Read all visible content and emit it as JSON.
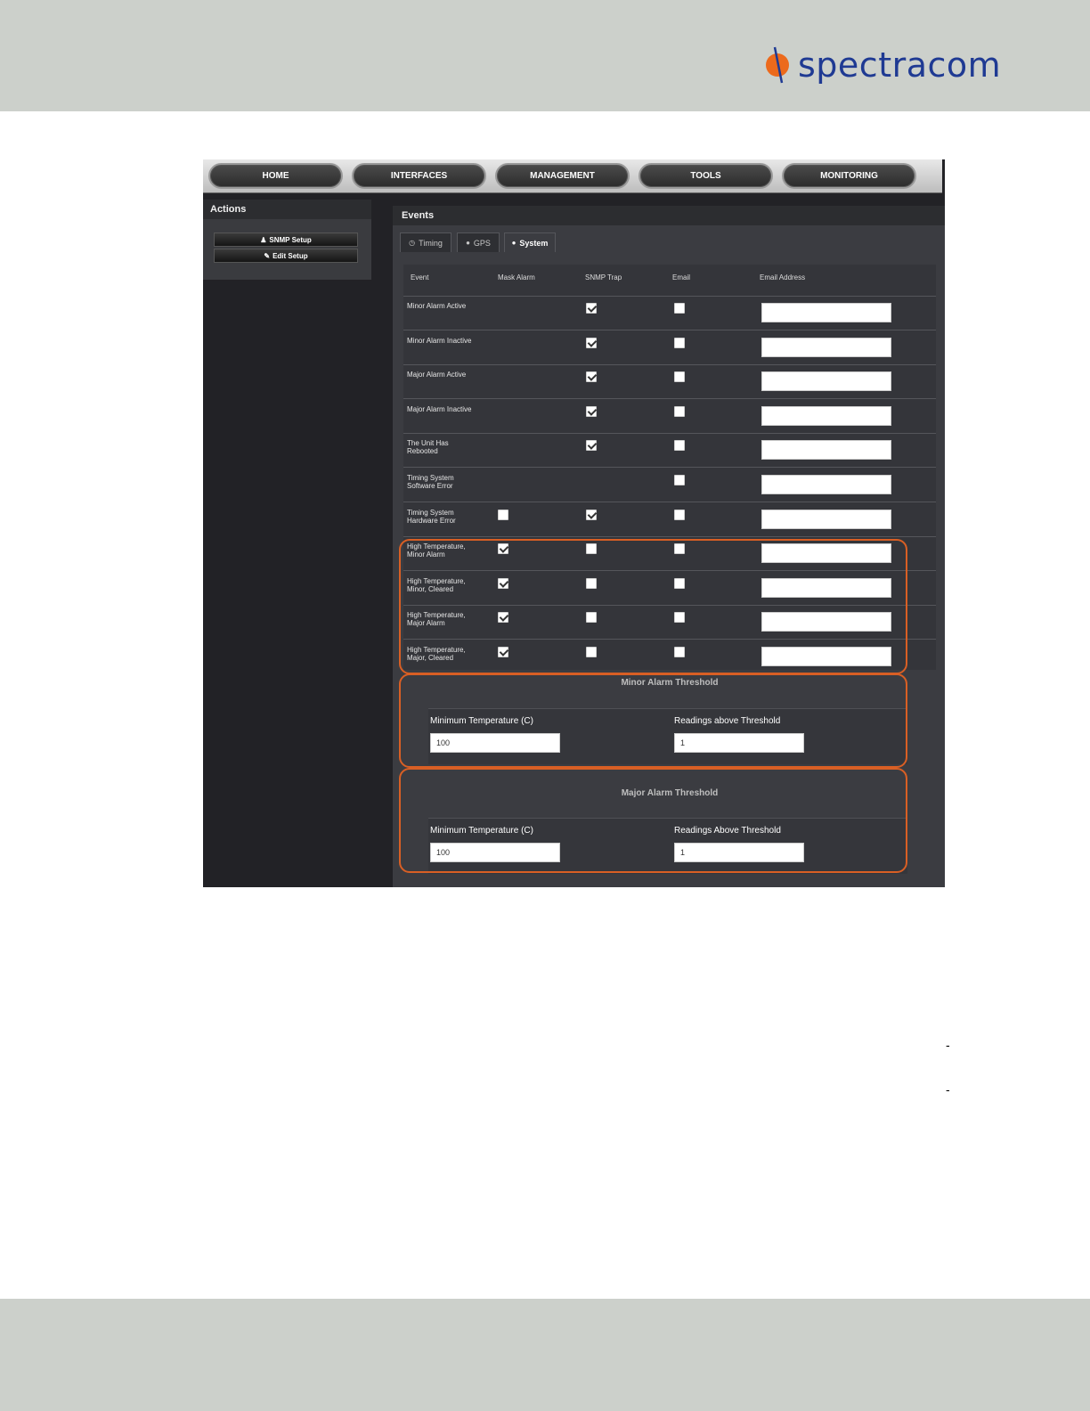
{
  "brand": {
    "logo_text": "spectracom",
    "colors": {
      "band": "#ccd0cb",
      "logo_blue": "#1f3a93",
      "logo_orange": "#ec6a1c",
      "highlight": "#d95f24"
    }
  },
  "nav": {
    "items": [
      "HOME",
      "INTERFACES",
      "MANAGEMENT",
      "TOOLS",
      "MONITORING"
    ]
  },
  "actions": {
    "title": "Actions",
    "buttons": [
      {
        "icon": "user-icon",
        "label": "SNMP Setup"
      },
      {
        "icon": "edit-icon",
        "label": "Edit Setup"
      }
    ]
  },
  "events": {
    "title": "Events",
    "tabs": [
      {
        "label": "Timing",
        "icon": "clock-icon",
        "active": false
      },
      {
        "label": "GPS",
        "icon": "globe-icon",
        "active": false
      },
      {
        "label": "System",
        "icon": "globe-icon",
        "active": true
      }
    ],
    "columns": [
      "Event",
      "Mask Alarm",
      "SNMP Trap",
      "Email",
      "Email Address"
    ],
    "rows": [
      {
        "event": "Minor Alarm Active",
        "mask": null,
        "snmp": true,
        "email": false,
        "address": ""
      },
      {
        "event": "Minor Alarm Inactive",
        "mask": null,
        "snmp": true,
        "email": false,
        "address": ""
      },
      {
        "event": "Major Alarm Active",
        "mask": null,
        "snmp": true,
        "email": false,
        "address": ""
      },
      {
        "event": "Major Alarm Inactive",
        "mask": null,
        "snmp": true,
        "email": false,
        "address": ""
      },
      {
        "event": "The Unit Has\nRebooted",
        "mask": null,
        "snmp": true,
        "email": false,
        "address": ""
      },
      {
        "event": "Timing System\nSoftware Error",
        "mask": null,
        "snmp": null,
        "email": false,
        "address": ""
      },
      {
        "event": "Timing System\nHardware Error",
        "mask": false,
        "snmp": true,
        "email": false,
        "address": ""
      },
      {
        "event": "High Temperature,\nMinor Alarm",
        "mask": true,
        "snmp": false,
        "email": false,
        "address": ""
      },
      {
        "event": "High Temperature,\nMinor, Cleared",
        "mask": true,
        "snmp": false,
        "email": false,
        "address": ""
      },
      {
        "event": "High Temperature,\nMajor Alarm",
        "mask": true,
        "snmp": false,
        "email": false,
        "address": ""
      },
      {
        "event": "High Temperature,\nMajor, Cleared",
        "mask": true,
        "snmp": false,
        "email": false,
        "address": ""
      }
    ]
  },
  "minor_threshold": {
    "title": "Minor Alarm Threshold",
    "min_temp_label": "Minimum Temperature (C)",
    "min_temp_value": "100",
    "readings_label": "Readings above Threshold",
    "readings_value": "1"
  },
  "major_threshold": {
    "title": "Major Alarm Threshold",
    "min_temp_label": "Minimum Temperature (C)",
    "min_temp_value": "100",
    "readings_label": "Readings Above Threshold",
    "readings_value": "1"
  },
  "page_marks": [
    "-",
    "-"
  ]
}
